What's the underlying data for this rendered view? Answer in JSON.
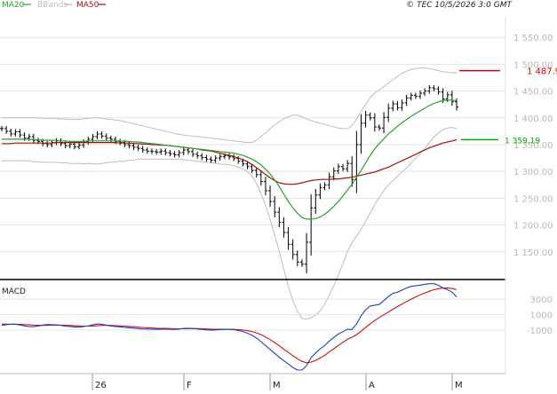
{
  "header": {
    "legend": [
      {
        "label": "MA20",
        "color": "#2ca02c"
      },
      {
        "label": "BBands",
        "color": "#bbbbbb"
      },
      {
        "label": "MA50",
        "color": "#a01010"
      }
    ],
    "copyright": "© TEC 10/5/2026 3:0 GMT"
  },
  "macd_panel": {
    "label": "MACD"
  },
  "markers": {
    "resistance": {
      "value": 1487.9,
      "label": "1 487.9",
      "color": "#dd0000"
    },
    "support": {
      "value": 1359.19,
      "label": "1 359.19",
      "color": "#00aa00"
    }
  },
  "chart_data": [
    {
      "type": "line",
      "subtype": "ohlc",
      "title": "",
      "y_ticks": [
        1150,
        1200,
        1250,
        1300,
        1350,
        1400,
        1450,
        1500,
        1550
      ],
      "y_tick_labels": [
        "1 150.00",
        "1 200.00",
        "1 250.00",
        "1 300.00",
        "1 350.00",
        "1 400.00",
        "1 450.00",
        "1 500.00",
        "1 550.00"
      ],
      "ylim": [
        1100,
        1590
      ],
      "x_tick_labels": [
        "26",
        "F",
        "M",
        "A",
        "M"
      ],
      "grid": true,
      "series": [
        {
          "name": "Price",
          "values": [
            1380,
            1375,
            1370,
            1374,
            1368,
            1362,
            1365,
            1358,
            1356,
            1352,
            1350,
            1354,
            1357,
            1352,
            1348,
            1351,
            1346,
            1349,
            1355,
            1360,
            1365,
            1370,
            1366,
            1362,
            1360,
            1356,
            1354,
            1350,
            1348,
            1345,
            1343,
            1340,
            1338,
            1337,
            1336,
            1338,
            1335,
            1333,
            1331,
            1335,
            1340,
            1337,
            1332,
            1329,
            1326,
            1323,
            1321,
            1325,
            1328,
            1329,
            1327,
            1324,
            1319,
            1314,
            1309,
            1302,
            1294,
            1281,
            1264,
            1244,
            1224,
            1205,
            1186,
            1164,
            1145,
            1131,
            1127,
            1168,
            1232,
            1256,
            1270,
            1275,
            1290,
            1301,
            1309,
            1305,
            1315,
            1285,
            1350,
            1390,
            1405,
            1400,
            1383,
            1381,
            1401,
            1418,
            1426,
            1419,
            1428,
            1437,
            1442,
            1440,
            1446,
            1450,
            1456,
            1454,
            1448,
            1435,
            1443,
            1430,
            1420
          ]
        },
        {
          "name": "MA20",
          "values": [
            1360,
            1360,
            1360,
            1360,
            1360,
            1360,
            1360,
            1359,
            1359,
            1358,
            1358,
            1358,
            1358,
            1357,
            1357,
            1356,
            1356,
            1356,
            1356,
            1357,
            1357,
            1357,
            1357,
            1357,
            1357,
            1357,
            1357,
            1356,
            1356,
            1355,
            1355,
            1354,
            1353,
            1352,
            1351,
            1350,
            1349,
            1348,
            1347,
            1346,
            1345,
            1344,
            1343,
            1342,
            1341,
            1340,
            1339,
            1338,
            1337,
            1336,
            1335,
            1334,
            1332,
            1330,
            1327,
            1323,
            1318,
            1312,
            1304,
            1295,
            1284,
            1272,
            1258,
            1244,
            1232,
            1222,
            1214,
            1211,
            1211,
            1212,
            1215,
            1220,
            1227,
            1235,
            1244,
            1254,
            1265,
            1276,
            1289,
            1302,
            1316,
            1330,
            1342,
            1352,
            1361,
            1370,
            1377,
            1384,
            1391,
            1397,
            1403,
            1408,
            1413,
            1418,
            1423,
            1427,
            1430,
            1432,
            1433,
            1433,
            1432
          ]
        },
        {
          "name": "MA50",
          "values": [
            1352,
            1352,
            1352,
            1353,
            1353,
            1353,
            1353,
            1353,
            1353,
            1353,
            1353,
            1353,
            1354,
            1354,
            1354,
            1354,
            1354,
            1354,
            1354,
            1354,
            1354,
            1354,
            1354,
            1354,
            1354,
            1354,
            1353,
            1353,
            1353,
            1352,
            1352,
            1351,
            1351,
            1350,
            1350,
            1349,
            1349,
            1348,
            1347,
            1346,
            1345,
            1344,
            1343,
            1342,
            1340,
            1339,
            1338,
            1336,
            1334,
            1332,
            1330,
            1328,
            1325,
            1322,
            1318,
            1313,
            1307,
            1301,
            1294,
            1288,
            1283,
            1279,
            1277,
            1276,
            1276,
            1277,
            1279,
            1281,
            1283,
            1284,
            1285,
            1285,
            1285,
            1286,
            1286,
            1287,
            1288,
            1289,
            1291,
            1293,
            1295,
            1297,
            1299,
            1302,
            1305,
            1308,
            1312,
            1316,
            1320,
            1324,
            1328,
            1332,
            1336,
            1340,
            1344,
            1347,
            1350,
            1353,
            1355,
            1357,
            1359
          ]
        },
        {
          "name": "BBands upper",
          "values": [
            1400,
            1400,
            1400,
            1400,
            1400,
            1400,
            1400,
            1400,
            1400,
            1399,
            1399,
            1399,
            1399,
            1398,
            1398,
            1397,
            1397,
            1397,
            1398,
            1399,
            1400,
            1400,
            1399,
            1398,
            1397,
            1396,
            1395,
            1393,
            1391,
            1389,
            1387,
            1385,
            1383,
            1381,
            1379,
            1377,
            1375,
            1373,
            1371,
            1369,
            1368,
            1367,
            1366,
            1365,
            1364,
            1363,
            1362,
            1361,
            1360,
            1359,
            1358,
            1357,
            1356,
            1355,
            1354,
            1354,
            1358,
            1365,
            1372,
            1380,
            1387,
            1393,
            1398,
            1402,
            1405,
            1405,
            1402,
            1398,
            1395,
            1392,
            1390,
            1388,
            1385,
            1383,
            1381,
            1380,
            1380,
            1385,
            1398,
            1412,
            1425,
            1438,
            1446,
            1452,
            1458,
            1465,
            1471,
            1477,
            1483,
            1487,
            1490,
            1492,
            1493,
            1493,
            1492,
            1490,
            1488,
            1486,
            1485,
            1484,
            1484
          ]
        },
        {
          "name": "BBands lower",
          "values": [
            1320,
            1320,
            1320,
            1320,
            1320,
            1320,
            1320,
            1318,
            1318,
            1317,
            1317,
            1317,
            1317,
            1316,
            1316,
            1315,
            1315,
            1315,
            1314,
            1315,
            1314,
            1314,
            1315,
            1316,
            1317,
            1318,
            1319,
            1319,
            1321,
            1321,
            1323,
            1323,
            1323,
            1323,
            1323,
            1323,
            1323,
            1323,
            1323,
            1323,
            1322,
            1321,
            1320,
            1319,
            1318,
            1317,
            1316,
            1315,
            1314,
            1313,
            1312,
            1311,
            1308,
            1305,
            1300,
            1292,
            1278,
            1259,
            1236,
            1210,
            1181,
            1151,
            1118,
            1086,
            1059,
            1039,
            1026,
            1024,
            1027,
            1032,
            1040,
            1052,
            1069,
            1087,
            1107,
            1128,
            1150,
            1167,
            1180,
            1192,
            1207,
            1222,
            1238,
            1252,
            1264,
            1275,
            1283,
            1291,
            1299,
            1307,
            1316,
            1324,
            1333,
            1343,
            1354,
            1364,
            1372,
            1378,
            1381,
            1382,
            1380
          ]
        }
      ]
    },
    {
      "type": "line",
      "title": "MACD",
      "y_ticks": [
        -1000,
        1000,
        3000
      ],
      "y_tick_labels": [
        "-1000",
        "1000",
        "3000"
      ],
      "ylim": [
        -6500,
        5200
      ],
      "grid": true,
      "series": [
        {
          "name": "MACD",
          "values": [
            -380,
            -290,
            -230,
            -240,
            -330,
            -460,
            -520,
            -560,
            -460,
            -350,
            -270,
            -290,
            -330,
            -390,
            -490,
            -540,
            -580,
            -610,
            -540,
            -450,
            -320,
            -200,
            -240,
            -350,
            -450,
            -520,
            -570,
            -640,
            -690,
            -740,
            -800,
            -840,
            -860,
            -880,
            -890,
            -870,
            -860,
            -880,
            -900,
            -860,
            -780,
            -750,
            -790,
            -840,
            -900,
            -960,
            -1000,
            -970,
            -920,
            -900,
            -900,
            -940,
            -1040,
            -1180,
            -1390,
            -1660,
            -2010,
            -2480,
            -3000,
            -3500,
            -4000,
            -4480,
            -4940,
            -5380,
            -5840,
            -6140,
            -6160,
            -5580,
            -4550,
            -3940,
            -3400,
            -3000,
            -2420,
            -1940,
            -1500,
            -1200,
            -880,
            -920,
            -200,
            860,
            1640,
            2120,
            2230,
            2320,
            2820,
            3340,
            3770,
            3900,
            4180,
            4450,
            4660,
            4730,
            4820,
            4920,
            5010,
            5000,
            4810,
            4450,
            4240,
            3900,
            3300
          ]
        },
        {
          "name": "Signal",
          "values": [
            -210,
            -230,
            -240,
            -230,
            -250,
            -280,
            -310,
            -350,
            -380,
            -390,
            -370,
            -350,
            -340,
            -350,
            -370,
            -400,
            -430,
            -460,
            -480,
            -480,
            -470,
            -430,
            -390,
            -380,
            -390,
            -420,
            -450,
            -480,
            -520,
            -560,
            -600,
            -650,
            -690,
            -720,
            -750,
            -770,
            -780,
            -800,
            -810,
            -820,
            -810,
            -800,
            -800,
            -800,
            -810,
            -840,
            -870,
            -880,
            -890,
            -890,
            -890,
            -900,
            -930,
            -980,
            -1060,
            -1180,
            -1350,
            -1580,
            -1880,
            -2220,
            -2600,
            -3010,
            -3450,
            -3880,
            -4300,
            -4700,
            -5030,
            -5220,
            -5140,
            -4920,
            -4610,
            -4240,
            -3820,
            -3400,
            -2970,
            -2570,
            -2190,
            -1920,
            -1570,
            -1130,
            -640,
            -170,
            250,
            630,
            990,
            1330,
            1700,
            2050,
            2380,
            2700,
            3010,
            3300,
            3560,
            3800,
            4030,
            4220,
            4360,
            4440,
            4450,
            4380,
            4220
          ]
        }
      ]
    }
  ]
}
